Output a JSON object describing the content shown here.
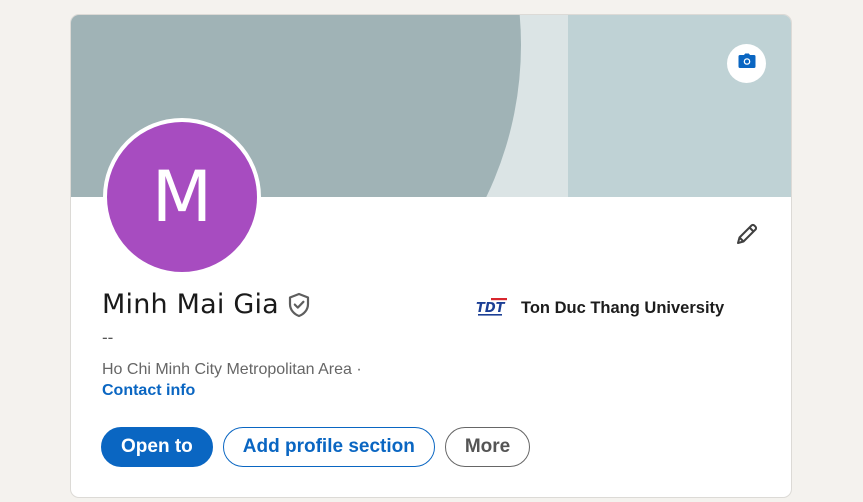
{
  "profile": {
    "avatar_letter": "M",
    "name": "Minh Mai Gia",
    "headline": "--",
    "location": "Ho Chi Minh City Metropolitan Area ·",
    "contact_label": "Contact info"
  },
  "education": {
    "logo_text": "TDT",
    "school_name": "Ton Duc Thang University"
  },
  "actions": {
    "open_to": "Open to",
    "add_section": "Add profile section",
    "more": "More"
  },
  "icons": {
    "camera": "camera-icon",
    "edit": "pencil-icon",
    "verify": "shield-check-icon"
  },
  "colors": {
    "accent": "#0a66c2",
    "avatar_bg": "#a74cc0",
    "banner_dark": "#a0b3b6",
    "banner_light": "#dbe4e5",
    "banner_right": "#bfd2d5"
  }
}
